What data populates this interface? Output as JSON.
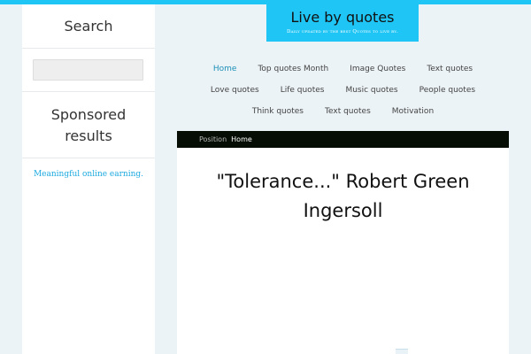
{
  "sidebar": {
    "search_heading": "Search",
    "search_value": "",
    "sponsored_heading_line1": "Sponsored",
    "sponsored_heading_line2": "results",
    "sponsored_link": "Meaningful online earning."
  },
  "logo": {
    "title": "Live by quotes",
    "tagline": "Daily updated by the best Quotes to live by."
  },
  "nav": {
    "rows": [
      [
        "Home",
        "Top quotes Month",
        "Image Quotes",
        "Text quotes"
      ],
      [
        "Love quotes",
        "Life quotes",
        "Music quotes",
        "People quotes"
      ],
      [
        "Think quotes",
        "Text quotes",
        "Motivation"
      ]
    ],
    "active": "Home"
  },
  "breadcrumb": {
    "label": "Position",
    "home": "Home"
  },
  "post": {
    "title": "\"Tolerance...\" Robert Green Ingersoll"
  },
  "colors": {
    "accent": "#1ec5f5",
    "background": "#ecf3f6",
    "breadcrumb_bg": "#060d05",
    "link": "#1ba9e0"
  }
}
